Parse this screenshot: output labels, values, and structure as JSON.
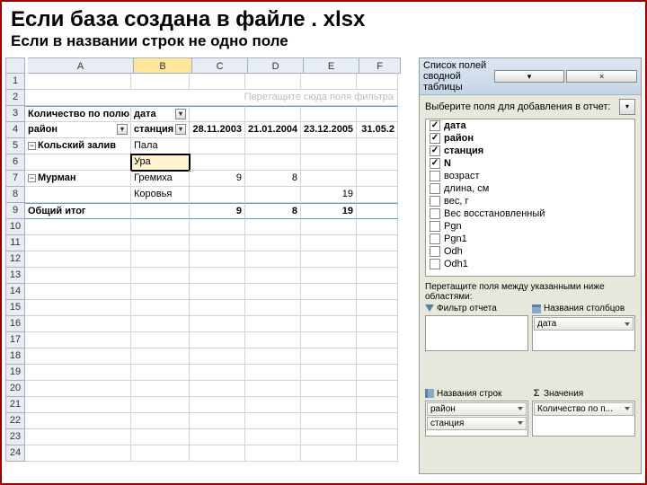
{
  "title": "Если база создана в файле . xlsx",
  "subtitle": "Если в названии строк не одно поле",
  "cols": [
    "A",
    "B",
    "C",
    "D",
    "E",
    "F"
  ],
  "row_count": 24,
  "hint": "Перетащите сюда поля фильтра",
  "pivot": {
    "count_label": "Количество по полю N",
    "date_label": "дата",
    "row1_label": "район",
    "row2_label": "станция",
    "dates": [
      "28.11.2003",
      "21.01.2004",
      "23.12.2005",
      "31.05.2"
    ],
    "groups": [
      {
        "name": "Кольский залив",
        "stations": [
          "Пала",
          "Ура"
        ],
        "vals": [
          [
            "",
            "",
            "",
            ""
          ],
          [
            "",
            "",
            "",
            ""
          ]
        ]
      },
      {
        "name": "Мурман",
        "stations": [
          "Гремиха",
          "Коровья"
        ],
        "vals": [
          [
            "9",
            "8",
            "",
            ""
          ],
          [
            "",
            "",
            "19",
            ""
          ]
        ]
      }
    ],
    "total_label": "Общий итог",
    "totals": [
      "9",
      "8",
      "19",
      ""
    ]
  },
  "pane": {
    "title": "Список полей сводной таблицы",
    "choose": "Выберите поля для добавления в отчет:",
    "fields": [
      {
        "label": "дата",
        "checked": true,
        "bold": true
      },
      {
        "label": "район",
        "checked": true,
        "bold": true
      },
      {
        "label": "станция",
        "checked": true,
        "bold": true
      },
      {
        "label": "N",
        "checked": true,
        "bold": true
      },
      {
        "label": "возраст",
        "checked": false
      },
      {
        "label": "длина, см",
        "checked": false
      },
      {
        "label": "вес, г",
        "checked": false
      },
      {
        "label": "Вес восстановленный",
        "checked": false
      },
      {
        "label": "Pgn",
        "checked": false
      },
      {
        "label": "Pgn1",
        "checked": false
      },
      {
        "label": "Odh",
        "checked": false
      },
      {
        "label": "Odh1",
        "checked": false
      }
    ],
    "drag_label": "Перетащите поля между указанными ниже областями:",
    "filter_hd": "Фильтр отчета",
    "cols_hd": "Названия столбцов",
    "rows_hd": "Названия строк",
    "vals_hd": "Значения",
    "col_items": [
      "дата"
    ],
    "row_items": [
      "район",
      "станция"
    ],
    "val_items": [
      "Количество по п..."
    ]
  }
}
